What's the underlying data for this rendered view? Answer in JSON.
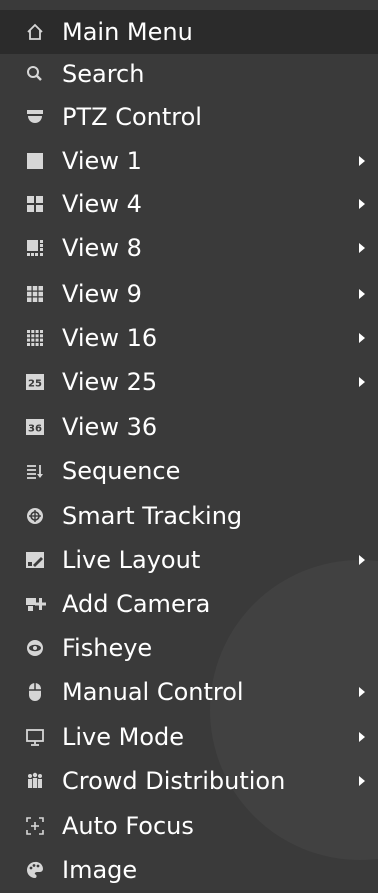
{
  "menu": {
    "items": [
      {
        "label": "Main Menu"
      },
      {
        "label": "Search"
      },
      {
        "label": "PTZ Control"
      },
      {
        "label": "View 1"
      },
      {
        "label": "View 4"
      },
      {
        "label": "View 8"
      },
      {
        "label": "View 9"
      },
      {
        "label": "View 16"
      },
      {
        "label": "View 25",
        "icon_text": "25"
      },
      {
        "label": "View 36",
        "icon_text": "36"
      },
      {
        "label": "Sequence"
      },
      {
        "label": "Smart Tracking"
      },
      {
        "label": "Live Layout"
      },
      {
        "label": "Add Camera"
      },
      {
        "label": "Fisheye"
      },
      {
        "label": "Manual Control"
      },
      {
        "label": "Live Mode"
      },
      {
        "label": "Crowd Distribution"
      },
      {
        "label": "Auto Focus"
      },
      {
        "label": "Image"
      }
    ]
  },
  "colors": {
    "background": "#3a3a3a",
    "active_row": "#2b2b2b",
    "text": "#ffffff",
    "icon": "#d6d6d6"
  }
}
